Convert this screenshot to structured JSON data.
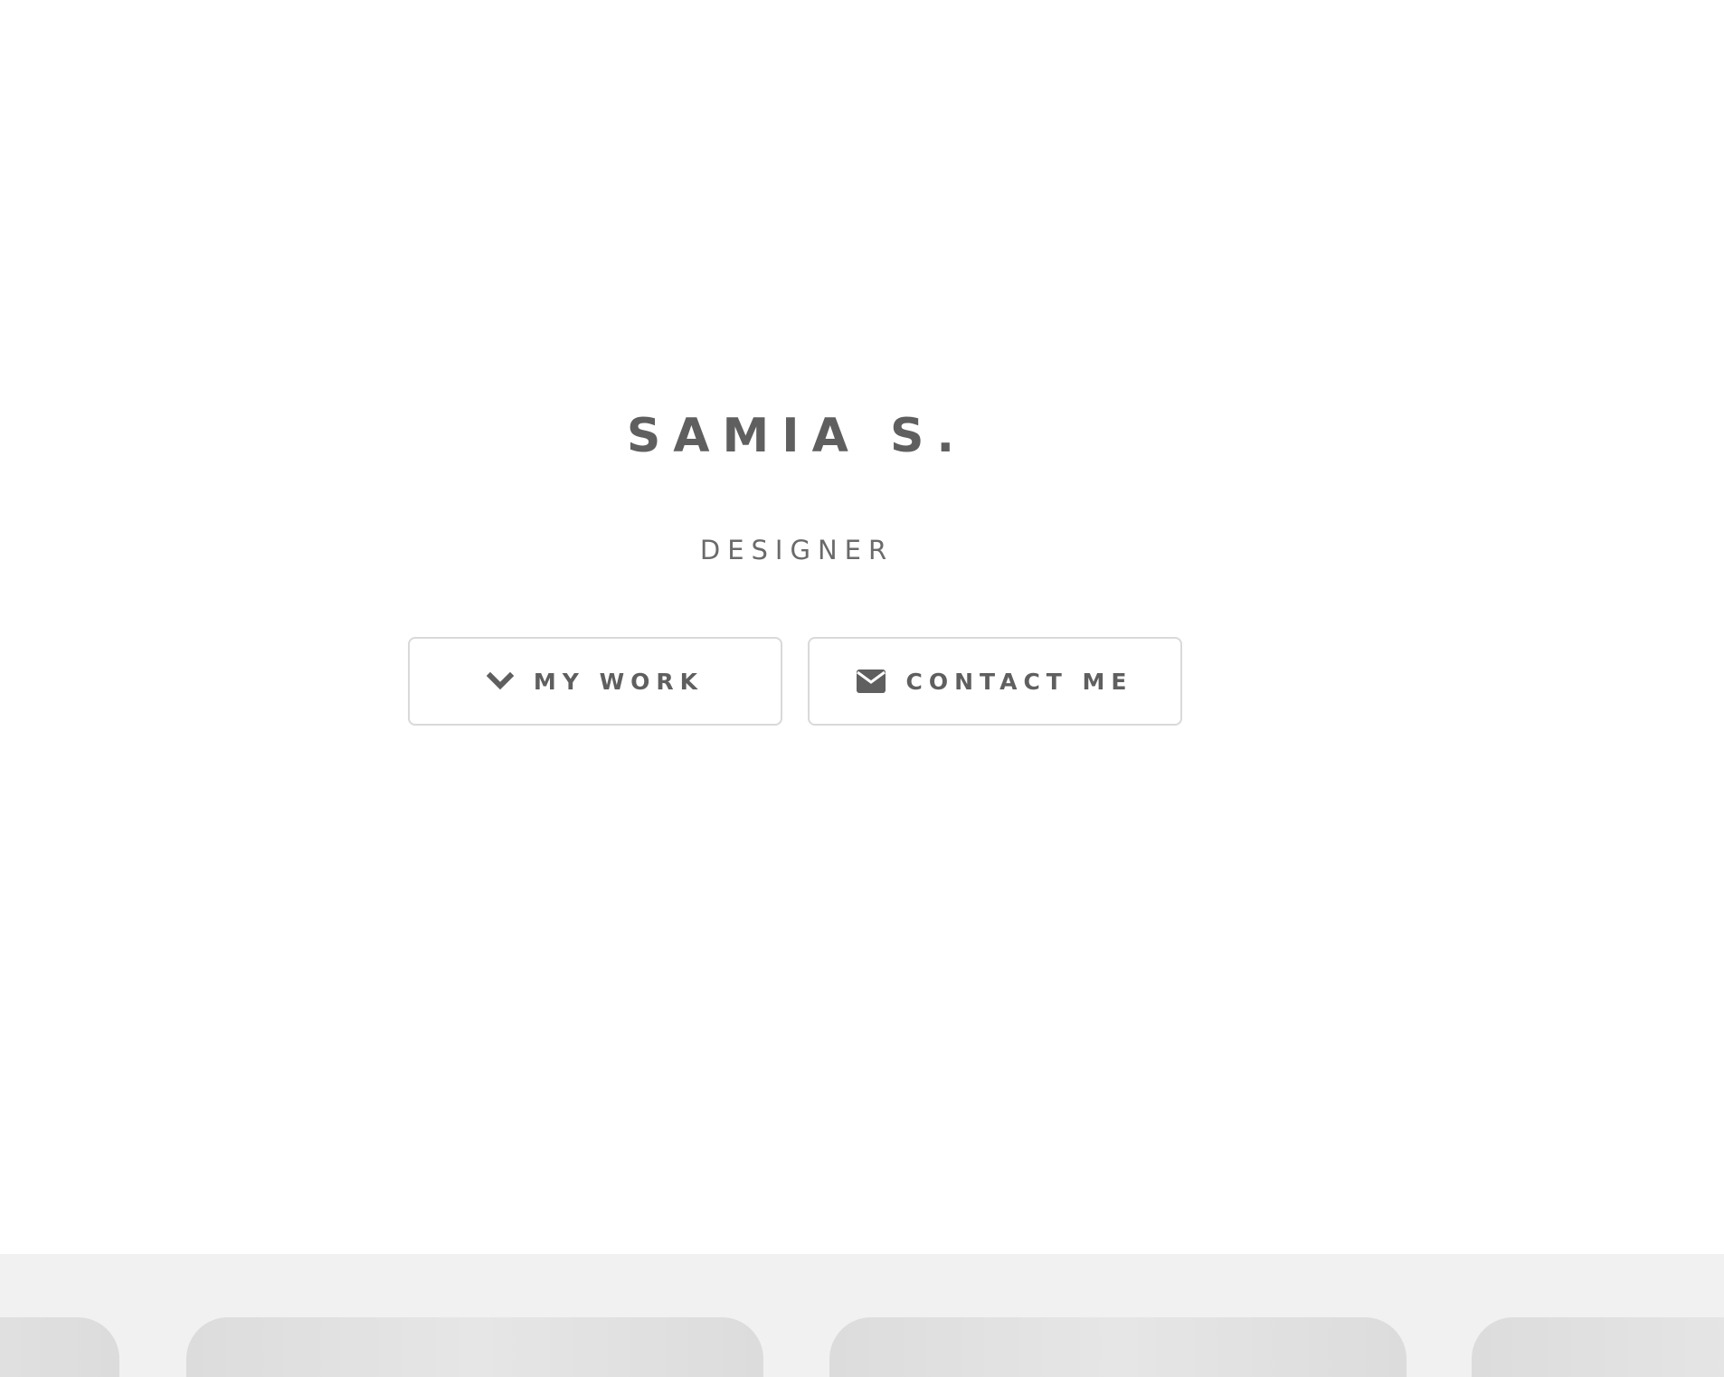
{
  "hero": {
    "name": "SAMIA S.",
    "role": "DESIGNER"
  },
  "buttons": {
    "my_work": {
      "label": "MY WORK",
      "icon": "chevron-down-icon"
    },
    "contact": {
      "label": "CONTACT ME",
      "icon": "envelope-icon"
    }
  },
  "colors": {
    "text": "#5f5f5f",
    "button_border": "#d9d9d9",
    "band_background": "#f1f1f1",
    "card": "#dcdcdc"
  }
}
